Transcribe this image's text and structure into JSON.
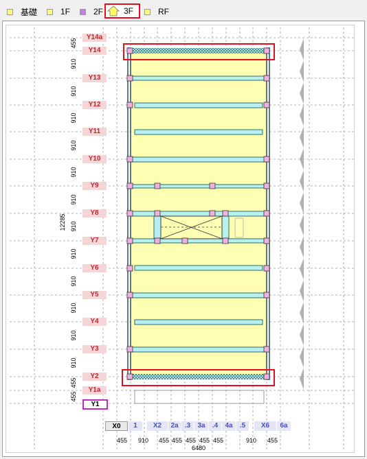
{
  "tabs": [
    {
      "label": "基礎",
      "color": "#ffff80"
    },
    {
      "label": "1F",
      "color": "#ffff80"
    },
    {
      "label": "2F",
      "color": "#c080e0"
    },
    {
      "label": "3F",
      "color": "#ffff80",
      "active": true
    },
    {
      "label": "RF",
      "color": "#ffff80"
    }
  ],
  "y_grid": {
    "labels": [
      "Y14a",
      "Y14",
      "Y13",
      "Y12",
      "Y11",
      "Y10",
      "Y9",
      "Y8",
      "Y7",
      "Y6",
      "Y5",
      "Y4",
      "Y3",
      "Y2",
      "Y1a",
      "Y1"
    ],
    "selected": "Y1",
    "spacings": [
      "455",
      "910",
      "910",
      "910",
      "910",
      "910",
      "910",
      "910",
      "910",
      "910",
      "910",
      "910",
      "910",
      "455",
      "455"
    ],
    "total": "12285"
  },
  "x_grid": {
    "labels": [
      "X0",
      "1",
      "X2",
      "2a",
      ".3",
      "3a",
      ".4",
      "4a",
      ".5",
      "X6",
      "6a"
    ],
    "spacings": [
      "455",
      "910",
      "455",
      "455",
      "455",
      "455",
      "455",
      "910",
      "455"
    ],
    "total": "6480"
  },
  "colors": {
    "floor": "#ffffb3",
    "beam": "#b8f0f0",
    "highlight": "#e0101e",
    "label_bg": "#f4d6d9",
    "label_text": "#c0282e"
  }
}
